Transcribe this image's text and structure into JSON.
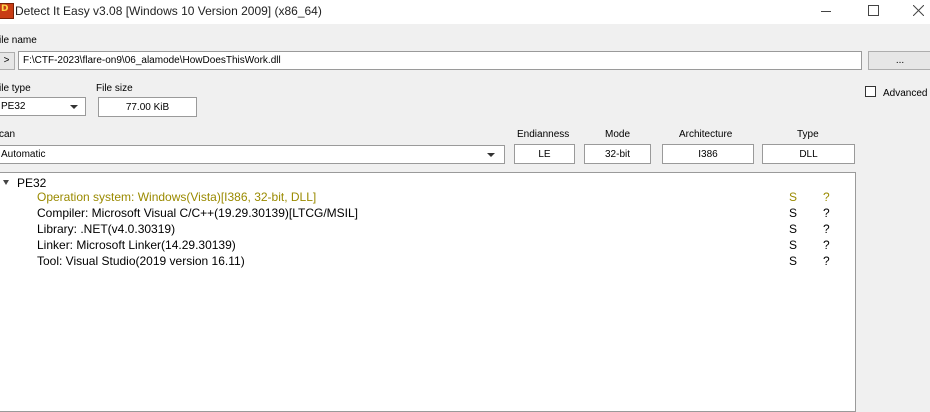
{
  "window": {
    "title": "Detect It Easy v3.08 [Windows 10 Version 2009] (x86_64)",
    "icon": "die-app-icon"
  },
  "file_name": {
    "label": "ile name",
    "nav_button": ">",
    "path": "F:\\CTF-2023\\flare-on9\\06_alamode\\HowDoesThisWork.dll",
    "browse_button": "..."
  },
  "file_type": {
    "label": "ile type",
    "value": "PE32"
  },
  "file_size": {
    "label": "File size",
    "value": "77.00 KiB"
  },
  "advanced": {
    "label": "Advanced",
    "checked": false
  },
  "scan": {
    "label": "can",
    "value": "Automatic"
  },
  "info": {
    "endianness": {
      "label": "Endianness",
      "value": "LE"
    },
    "mode": {
      "label": "Mode",
      "value": "32-bit"
    },
    "architecture": {
      "label": "Architecture",
      "value": "I386"
    },
    "type": {
      "label": "Type",
      "value": "DLL"
    }
  },
  "results": {
    "root": "PE32",
    "highlight_color": "#9a8a00",
    "items": [
      {
        "text": "Operation system: Windows(Vista)[I386, 32-bit, DLL]",
        "s": "S",
        "q": "?",
        "highlight": true
      },
      {
        "text": "Compiler: Microsoft Visual C/C++(19.29.30139)[LTCG/MSIL]",
        "s": "S",
        "q": "?",
        "highlight": false
      },
      {
        "text": "Library: .NET(v4.0.30319)",
        "s": "S",
        "q": "?",
        "highlight": false
      },
      {
        "text": "Linker: Microsoft Linker(14.29.30139)",
        "s": "S",
        "q": "?",
        "highlight": false
      },
      {
        "text": "Tool: Visual Studio(2019 version 16.11)",
        "s": "S",
        "q": "?",
        "highlight": false
      }
    ]
  }
}
